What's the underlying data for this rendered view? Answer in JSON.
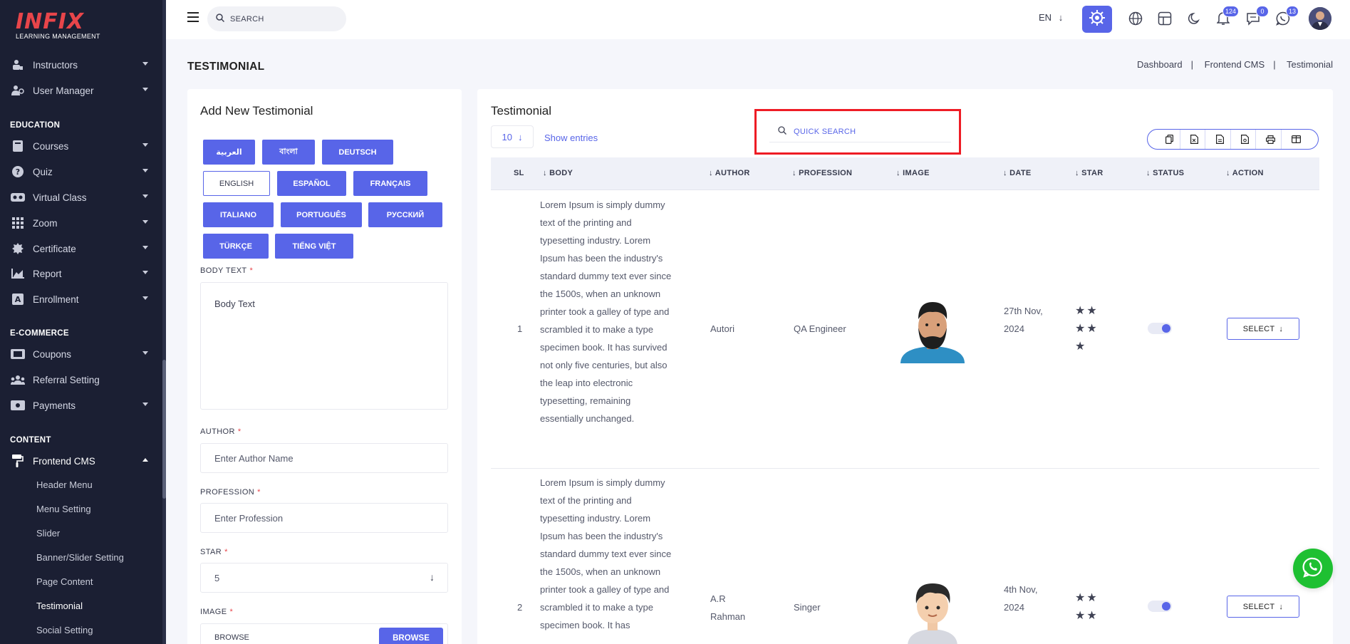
{
  "brand": {
    "logo": "INFIX",
    "tagline": "LEARNING MANAGEMENT"
  },
  "sidebar": {
    "items_top": [
      {
        "label": "Instructors",
        "icon": "instructor-icon"
      },
      {
        "label": "User Manager",
        "icon": "users-icon"
      }
    ],
    "section_education": "EDUCATION",
    "items_education": [
      {
        "label": "Courses",
        "icon": "book-icon"
      },
      {
        "label": "Quiz",
        "icon": "question-icon"
      },
      {
        "label": "Virtual Class",
        "icon": "vr-icon"
      },
      {
        "label": "Zoom",
        "icon": "grid-icon"
      },
      {
        "label": "Certificate",
        "icon": "badge-icon"
      },
      {
        "label": "Report",
        "icon": "chart-icon"
      },
      {
        "label": "Enrollment",
        "icon": "enroll-icon"
      }
    ],
    "section_ecommerce": "E-COMMERCE",
    "items_ecommerce": [
      {
        "label": "Coupons",
        "icon": "ticket-icon"
      },
      {
        "label": "Referral Setting",
        "icon": "referral-icon"
      },
      {
        "label": "Payments",
        "icon": "money-icon"
      }
    ],
    "section_content": "CONTENT",
    "frontend_cms": "Frontend CMS",
    "sub_items": [
      "Header Menu",
      "Menu Setting",
      "Slider",
      "Banner/Slider Setting",
      "Page Content",
      "Testimonial",
      "Social Setting"
    ]
  },
  "topbar": {
    "search_placeholder": "SEARCH",
    "lang": "EN",
    "badges": {
      "notifications": "124",
      "messages": "0",
      "whatsapp": "13"
    }
  },
  "page": {
    "title": "TESTIMONIAL",
    "breadcrumb": [
      "Dashboard",
      "Frontend CMS",
      "Testimonial"
    ]
  },
  "form": {
    "title": "Add New Testimonial",
    "languages": [
      "العربية",
      "বাংলা",
      "DEUTSCH",
      "ENGLISH",
      "ESPAÑOL",
      "FRANÇAIS",
      "ITALIANO",
      "PORTUGUÊS",
      "РУССКИЙ",
      "TÜRKÇE",
      "TIẾNG VIỆT"
    ],
    "body_label": "BODY TEXT",
    "body_placeholder": "Body Text",
    "author_label": "AUTHOR",
    "author_placeholder": "Enter Author Name",
    "profession_label": "PROFESSION",
    "profession_placeholder": "Enter Profession",
    "star_label": "STAR",
    "star_value": "5",
    "image_label": "IMAGE",
    "browse_text": "BROWSE",
    "browse_button": "BROWSE",
    "required_mark": "*"
  },
  "list": {
    "title": "Testimonial",
    "entries_value": "10",
    "entries_label": "Show entries",
    "quick_search": "QUICK SEARCH",
    "columns": [
      "SL",
      "BODY",
      "AUTHOR",
      "PROFESSION",
      "IMAGE",
      "DATE",
      "STAR",
      "STATUS",
      "ACTION"
    ],
    "rows": [
      {
        "sl": "1",
        "body": "Lorem Ipsum is simply dummy text of the printing and typesetting industry. Lorem Ipsum has been the industry's standard dummy text ever since the 1500s, when an unknown printer took a galley of type and scrambled it to make a type specimen book. It has survived not only five centuries, but also the leap into electronic typesetting, remaining essentially unchanged.",
        "author": "Autori",
        "profession": "QA Engineer",
        "date": "27th Nov, 2024",
        "stars": 5,
        "status": true,
        "action": "SELECT"
      },
      {
        "sl": "2",
        "body": "Lorem Ipsum is simply dummy text of the printing and typesetting industry. Lorem Ipsum has been the industry's standard dummy text ever since the 1500s, when an unknown printer took a galley of type and scrambled it to make a type specimen book. It has",
        "author": "A.R Rahman",
        "profession": "Singer",
        "date": "4th Nov, 2024",
        "stars": 4,
        "status": true,
        "action": "SELECT"
      }
    ]
  },
  "colors": {
    "accent": "#5865e8",
    "sidebar": "#1b1f33",
    "highlight": "#ee1c25",
    "whatsapp": "#1ec032"
  }
}
